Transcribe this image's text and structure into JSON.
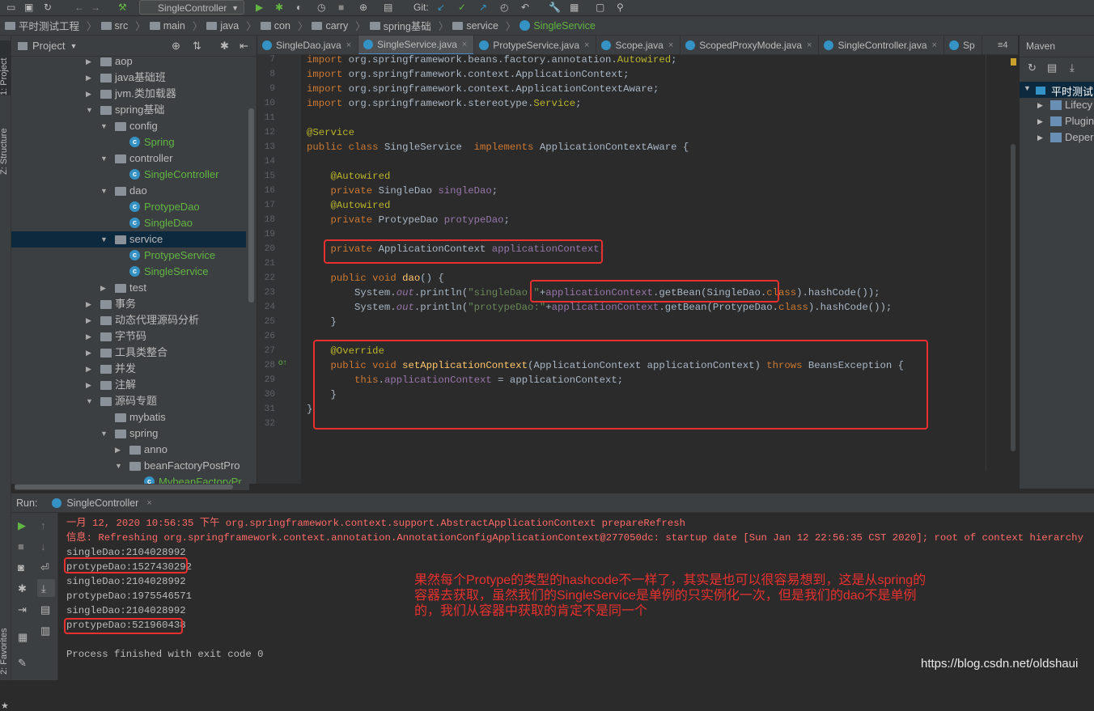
{
  "toolbar": {
    "run_config": "SingleController",
    "git_label": "Git:"
  },
  "breadcrumb": [
    "平时测试工程",
    "src",
    "main",
    "java",
    "con",
    "carry",
    "spring基础",
    "service",
    "SingleService"
  ],
  "left_strip": {
    "project": "1: Project",
    "structure": "Z: Structure",
    "favorites": "2: Favorites"
  },
  "project_panel": {
    "title": "Project"
  },
  "tree": [
    {
      "label": "aop",
      "depth": 0,
      "kind": "folder",
      "expanded": false
    },
    {
      "label": "java基础班",
      "depth": 0,
      "kind": "folder",
      "expanded": false
    },
    {
      "label": "jvm.类加载器",
      "depth": 0,
      "kind": "folder",
      "expanded": false
    },
    {
      "label": "spring基础",
      "depth": 0,
      "kind": "folder",
      "expanded": true
    },
    {
      "label": "config",
      "depth": 1,
      "kind": "folder",
      "expanded": true
    },
    {
      "label": "Spring",
      "depth": 2,
      "kind": "class"
    },
    {
      "label": "controller",
      "depth": 1,
      "kind": "folder",
      "expanded": true
    },
    {
      "label": "SingleController",
      "depth": 2,
      "kind": "class"
    },
    {
      "label": "dao",
      "depth": 1,
      "kind": "folder",
      "expanded": true
    },
    {
      "label": "ProtypeDao",
      "depth": 2,
      "kind": "class"
    },
    {
      "label": "SingleDao",
      "depth": 2,
      "kind": "class"
    },
    {
      "label": "service",
      "depth": 1,
      "kind": "folder",
      "expanded": true,
      "selected": true
    },
    {
      "label": "ProtypeService",
      "depth": 2,
      "kind": "class"
    },
    {
      "label": "SingleService",
      "depth": 2,
      "kind": "class"
    },
    {
      "label": "test",
      "depth": 1,
      "kind": "folder",
      "expanded": false
    },
    {
      "label": "事务",
      "depth": 0,
      "kind": "folder",
      "expanded": false
    },
    {
      "label": "动态代理源码分析",
      "depth": 0,
      "kind": "folder",
      "expanded": false
    },
    {
      "label": "字节码",
      "depth": 0,
      "kind": "folder",
      "expanded": false
    },
    {
      "label": "工具类整合",
      "depth": 0,
      "kind": "folder",
      "expanded": false
    },
    {
      "label": "并发",
      "depth": 0,
      "kind": "folder",
      "expanded": false
    },
    {
      "label": "注解",
      "depth": 0,
      "kind": "folder",
      "expanded": false
    },
    {
      "label": "源码专题",
      "depth": 0,
      "kind": "folder",
      "expanded": true
    },
    {
      "label": "mybatis",
      "depth": 1,
      "kind": "folder",
      "expanded": null
    },
    {
      "label": "spring",
      "depth": 1,
      "kind": "folder",
      "expanded": true
    },
    {
      "label": "anno",
      "depth": 2,
      "kind": "folder",
      "expanded": false
    },
    {
      "label": "beanFactoryPostPro",
      "depth": 2,
      "kind": "folder",
      "expanded": true
    },
    {
      "label": "MybeanFactoryPr",
      "depth": 3,
      "kind": "class"
    }
  ],
  "tabs": [
    {
      "label": "SingleDao.java",
      "active": false
    },
    {
      "label": "SingleService.java",
      "active": true
    },
    {
      "label": "ProtypeService.java",
      "active": false
    },
    {
      "label": "Scope.java",
      "active": false
    },
    {
      "label": "ScopedProxyMode.java",
      "active": false
    },
    {
      "label": "SingleController.java",
      "active": false
    },
    {
      "label": "Sp",
      "active": false
    }
  ],
  "tab_overflow": "≡4",
  "maven": {
    "title": "Maven",
    "root": "平时测试",
    "items": [
      "Lifecy",
      "Plugin",
      "Deper"
    ]
  },
  "line_numbers": [
    "7",
    "8",
    "9",
    "10",
    "11",
    "12",
    "13",
    "14",
    "15",
    "16",
    "17",
    "18",
    "19",
    "20",
    "21",
    "22",
    "23",
    "24",
    "25",
    "26",
    "27",
    "28",
    "29",
    "30",
    "31",
    "32"
  ],
  "code_lines": [
    [
      [
        "k",
        "import "
      ],
      [
        "",
        "org.springframework.beans.factory.annotation."
      ],
      [
        "a",
        "Autowired"
      ],
      [
        "",
        ";"
      ]
    ],
    [
      [
        "k",
        "import "
      ],
      [
        "",
        "org.springframework.context.ApplicationContext;"
      ]
    ],
    [
      [
        "k",
        "import "
      ],
      [
        "",
        "org.springframework.context.ApplicationContextAware;"
      ]
    ],
    [
      [
        "k",
        "import "
      ],
      [
        "",
        "org.springframework.stereotype."
      ],
      [
        "a",
        "Service"
      ],
      [
        "",
        ";"
      ]
    ],
    [],
    [
      [
        "a",
        "@Service"
      ]
    ],
    [
      [
        "k",
        "public class "
      ],
      [
        "",
        "SingleService  "
      ],
      [
        "k",
        "implements "
      ],
      [
        "",
        "ApplicationContextAware {"
      ]
    ],
    [],
    [
      [
        "",
        "    "
      ],
      [
        "a",
        "@Autowired"
      ]
    ],
    [
      [
        "",
        "    "
      ],
      [
        "k",
        "private "
      ],
      [
        "",
        "SingleDao "
      ],
      [
        "f",
        "singleDao"
      ],
      [
        "",
        ";"
      ]
    ],
    [
      [
        "",
        "    "
      ],
      [
        "a",
        "@Autowired"
      ]
    ],
    [
      [
        "",
        "    "
      ],
      [
        "k",
        "private "
      ],
      [
        "",
        "ProtypeDao "
      ],
      [
        "f",
        "protypeDao"
      ],
      [
        "",
        ";"
      ]
    ],
    [],
    [
      [
        "",
        "    "
      ],
      [
        "k",
        "private "
      ],
      [
        "",
        "ApplicationContext "
      ],
      [
        "f",
        "applicationContext"
      ],
      [
        "",
        ";"
      ]
    ],
    [],
    [
      [
        "",
        "    "
      ],
      [
        "k",
        "public void "
      ],
      [
        "m",
        "dao"
      ],
      [
        "",
        "() {"
      ]
    ],
    [
      [
        "",
        "        System."
      ],
      [
        "fi",
        "out"
      ],
      [
        "",
        ".println("
      ],
      [
        "s",
        "\"singleDao:\""
      ],
      [
        "",
        "+"
      ],
      [
        "f",
        "applicationContext"
      ],
      [
        "",
        ".getBean(SingleDao."
      ],
      [
        "k",
        "class"
      ],
      [
        "",
        ").hashCode());"
      ]
    ],
    [
      [
        "",
        "        System."
      ],
      [
        "fi",
        "out"
      ],
      [
        "",
        ".println("
      ],
      [
        "s",
        "\"protypeDao:\""
      ],
      [
        "",
        "+"
      ],
      [
        "f",
        "applicationContext"
      ],
      [
        "",
        ".getBean(ProtypeDao."
      ],
      [
        "k",
        "class"
      ],
      [
        "",
        ").hashCode());"
      ]
    ],
    [
      [
        "",
        "    }"
      ]
    ],
    [],
    [
      [
        "",
        "    "
      ],
      [
        "a",
        "@Override"
      ]
    ],
    [
      [
        "",
        "    "
      ],
      [
        "k",
        "public void "
      ],
      [
        "m",
        "setApplicationContext"
      ],
      [
        "",
        "(ApplicationContext applicationContext) "
      ],
      [
        "k",
        "throws "
      ],
      [
        "",
        "BeansException {"
      ]
    ],
    [
      [
        "",
        "        "
      ],
      [
        "k",
        "this"
      ],
      [
        "",
        "."
      ],
      [
        "f",
        "applicationContext"
      ],
      [
        "",
        " = applicationContext;"
      ]
    ],
    [
      [
        "",
        "    }"
      ]
    ],
    [
      [
        "",
        "}"
      ]
    ],
    []
  ],
  "run": {
    "label": "Run:",
    "config": "SingleController"
  },
  "console": [
    {
      "text": "一月 12, 2020 10:56:35 下午 org.springframework.context.support.AbstractApplicationContext prepareRefresh",
      "red": true
    },
    {
      "text": "信息: Refreshing org.springframework.context.annotation.AnnotationConfigApplicationContext@277050dc: startup date [Sun Jan 12 22:56:35 CST 2020]; root of context hierarchy",
      "red": true
    },
    {
      "text": "singleDao:2104028992",
      "red": false
    },
    {
      "text": "protypeDao:1527430292",
      "red": false
    },
    {
      "text": "singleDao:2104028992",
      "red": false
    },
    {
      "text": "protypeDao:1975546571",
      "red": false
    },
    {
      "text": "singleDao:2104028992",
      "red": false
    },
    {
      "text": "protypeDao:521960438",
      "red": false
    },
    {
      "text": "",
      "red": false
    },
    {
      "text": "Process finished with exit code 0",
      "red": false
    }
  ],
  "annotation": "果然每个Protype的类型的hashcode不一样了，其实是也可以很容易想到，这是从spring的容器去获取，虽然我们的SingleService是单例的只实例化一次，但是我们的dao不是单例的，我们从容器中获取的肯定不是同一个",
  "watermark": "https://blog.csdn.net/oldshaui",
  "colors": {
    "highlight_box": "#e8312f",
    "selection": "#0d293e",
    "class_text": "#62b543"
  }
}
